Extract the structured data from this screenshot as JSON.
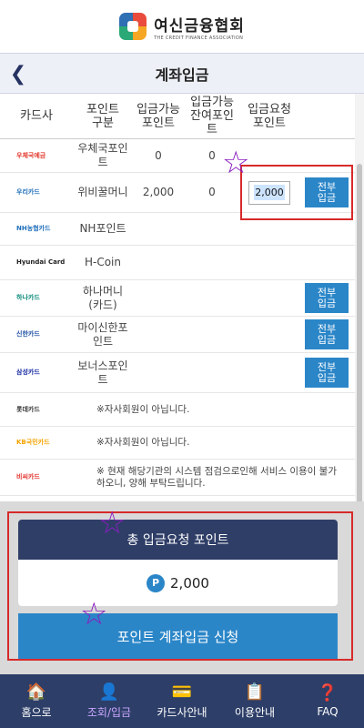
{
  "header": {
    "logo_text": "여신금융협회",
    "logo_sub": "THE CREDIT FINANCE ASSOCIATION",
    "title": "계좌입금",
    "back_icon": "chevron-left-icon"
  },
  "table": {
    "headers": [
      "카드사",
      "포인트 구분",
      "입금가능 포인트",
      "입금가능 잔여포인트",
      "입금요청 포인트",
      ""
    ],
    "rows": [
      {
        "card": "우체국예금",
        "point": "우체국포인트",
        "available": "0",
        "remaining": "0",
        "request": "",
        "button": "",
        "logo_color": "#e23a2e"
      },
      {
        "card": "우리카드",
        "point": "위비꿀머니",
        "available": "2,000",
        "remaining": "0",
        "request": "2,000",
        "button": "전부입금",
        "logo_color": "#1f6fba"
      },
      {
        "card": "NH농협카드",
        "point": "NH포인트",
        "available": "",
        "remaining": "",
        "request": "",
        "button": "",
        "logo_color": "#1f6fba"
      },
      {
        "card": "Hyundai Card",
        "point": "H-Coin",
        "available": "",
        "remaining": "",
        "request": "",
        "button": "",
        "logo_color": "#222222"
      },
      {
        "card": "하나카드",
        "point": "하나머니(카드)",
        "available": "",
        "remaining": "",
        "request": "",
        "button": "전부입금",
        "logo_color": "#0b8a7a"
      },
      {
        "card": "신한카드",
        "point": "마이신한포인트",
        "available": "",
        "remaining": "",
        "request": "",
        "button": "전부입금",
        "logo_color": "#1d4fa3"
      },
      {
        "card": "삼성카드",
        "point": "보너스포인트",
        "available": "",
        "remaining": "",
        "request": "",
        "button": "전부입금",
        "logo_color": "#1428a0"
      }
    ],
    "notes": [
      {
        "card": "롯데카드",
        "text": "※자사회원이 아닙니다.",
        "logo_color": "#333333"
      },
      {
        "card": "KB국민카드",
        "text": "※자사회원이 아닙니다.",
        "logo_color": "#f5a300"
      },
      {
        "card": "비씨카드",
        "text": "※ 현재 해당기관의 시스템 점검으로인해 서비스 이용이 불가 하오니, 양해 부탁드립니다.",
        "logo_color": "#e4312b"
      }
    ]
  },
  "summary": {
    "title": "총 입금요청 포인트",
    "badge": "P",
    "value": "2,000",
    "submit_label": "포인트 계좌입금 신청"
  },
  "nav": [
    {
      "label": "홈으로",
      "icon": "home-icon",
      "glyph": "🏠",
      "active": false
    },
    {
      "label": "조회/입금",
      "icon": "user-search-icon",
      "glyph": "👤",
      "active": true
    },
    {
      "label": "카드사안내",
      "icon": "card-icon",
      "glyph": "💳",
      "active": false
    },
    {
      "label": "이용안내",
      "icon": "guide-icon",
      "glyph": "📋",
      "active": false
    },
    {
      "label": "FAQ",
      "icon": "faq-icon",
      "glyph": "❓",
      "active": false
    }
  ],
  "colors": {
    "primary": "#2b86c8",
    "navy": "#2f3e67",
    "annotation_red": "#d72a2a",
    "annotation_star": "#8a1fbf"
  }
}
